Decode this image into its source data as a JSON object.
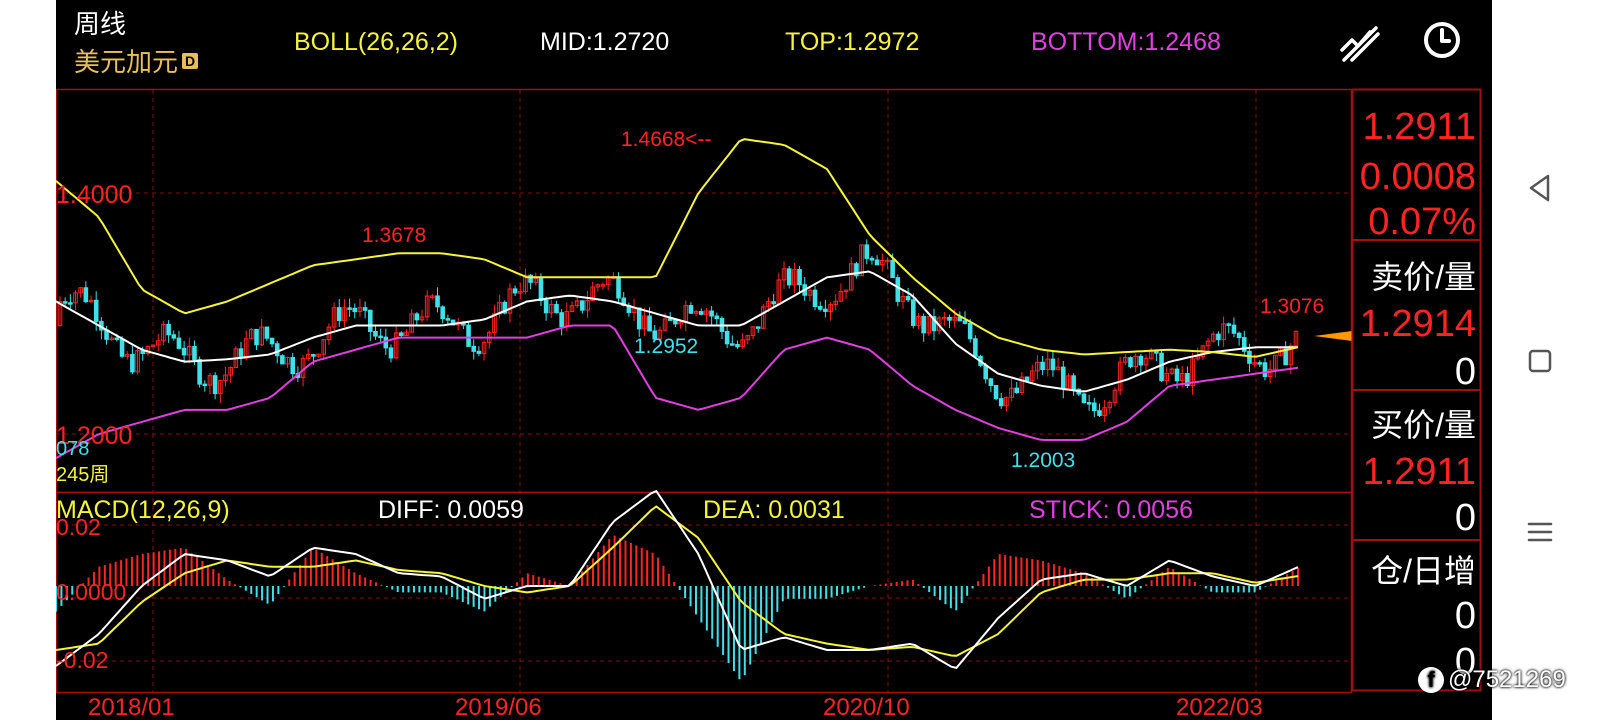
{
  "header": {
    "period": "周线",
    "instrument": "美元加元",
    "instrument_badge": "D",
    "boll_label": "BOLL(26,26,2)",
    "mid_label": "MID:1.2720",
    "top_label": "TOP:1.2972",
    "bottom_label": "BOTTOM:1.2468",
    "tool_icons": [
      "trend-line-icon",
      "clock-icon"
    ]
  },
  "quote_panel": {
    "price": "1.2911",
    "change": "0.0008",
    "change_pct": "0.07%",
    "ask_title": "卖价/量",
    "ask_price": "1.2914",
    "ask_volume": "0",
    "bid_title": "买价/量",
    "bid_price": "1.2911",
    "bid_volume": "0",
    "oi_title": "仓/日增",
    "oi_value": "0",
    "oi_change": "0"
  },
  "price_chart": {
    "y_tick_labels": [
      "1.4000",
      "1.2000"
    ],
    "left_value": "078",
    "left_period": "245周",
    "annotations": [
      "1.4668<--",
      "1.3678",
      "1.2952",
      "1.2003",
      "1.3076"
    ]
  },
  "macd_panel": {
    "label": "MACD(12,26,9)",
    "diff_label": "DIFF: 0.0059",
    "dea_label": "DEA: 0.0031",
    "stick_label": "STICK: 0.0056",
    "y_tick_labels": [
      "0.02",
      "0.0000",
      "-0.02"
    ]
  },
  "x_axis_labels": [
    "2018/01",
    "2019/06",
    "2020/10",
    "2022/03"
  ],
  "watermark": "@7521269",
  "colors": {
    "red": "#ff2424",
    "cyan": "#40e0e8",
    "yellow": "#f4f43c",
    "magenta": "#e040e0",
    "white": "#ffffff",
    "grid": "#8a1010",
    "background": "#000000"
  },
  "chart_data": [
    {
      "type": "candlestick",
      "title": "BOLL(26,26,2)",
      "ylim": [
        1.16,
        1.49
      ],
      "y_ticks": [
        1.4,
        1.2
      ],
      "x_ticks": [
        "2018/01",
        "2019/06",
        "2020/10",
        "2022/03"
      ],
      "grid": true,
      "series": [
        {
          "name": "MID",
          "values": [
            1.31,
            1.29,
            1.27,
            1.26,
            1.262,
            1.266,
            1.28,
            1.29,
            1.29,
            1.29,
            1.295,
            1.31,
            1.315,
            1.31,
            1.3,
            1.29,
            1.29,
            1.31,
            1.33,
            1.335,
            1.315,
            1.275,
            1.25,
            1.24,
            1.235,
            1.245,
            1.26,
            1.268,
            1.272,
            1.272
          ]
        },
        {
          "name": "TOP",
          "values": [
            1.41,
            1.38,
            1.32,
            1.3,
            1.31,
            1.325,
            1.34,
            1.345,
            1.35,
            1.35,
            1.345,
            1.33,
            1.33,
            1.33,
            1.33,
            1.4,
            1.445,
            1.44,
            1.42,
            1.365,
            1.33,
            1.3,
            1.28,
            1.27,
            1.266,
            1.268,
            1.27,
            1.268,
            1.264,
            1.272
          ]
        },
        {
          "name": "BOTTOM",
          "values": [
            1.18,
            1.2,
            1.21,
            1.22,
            1.22,
            1.23,
            1.26,
            1.27,
            1.28,
            1.28,
            1.28,
            1.28,
            1.29,
            1.29,
            1.23,
            1.22,
            1.23,
            1.27,
            1.28,
            1.27,
            1.24,
            1.22,
            1.205,
            1.195,
            1.195,
            1.21,
            1.24,
            1.245,
            1.25,
            1.255
          ]
        }
      ],
      "annotations": [
        {
          "label": "1.4668",
          "value": 1.4668
        },
        {
          "label": "1.3678",
          "value": 1.3678
        },
        {
          "label": "1.2952",
          "value": 1.2952
        },
        {
          "label": "1.2003",
          "value": 1.2003
        },
        {
          "label": "1.3076",
          "value": 1.3076
        }
      ],
      "last_price": 1.2911
    },
    {
      "type": "bar",
      "title": "MACD(12,26,9)",
      "ylim": [
        -0.03,
        0.027
      ],
      "y_ticks": [
        0.02,
        0,
        -0.02
      ],
      "series": [
        {
          "name": "DIFF",
          "values": [
            -0.025,
            -0.015,
            0.0,
            0.01,
            0.008,
            0.003,
            0.012,
            0.01,
            0.004,
            0.003,
            -0.004,
            0.0,
            0.0,
            0.02,
            0.03,
            0.01,
            -0.02,
            -0.016,
            -0.02,
            -0.02,
            -0.018,
            -0.026,
            -0.01,
            0.002,
            0.004,
            0.0,
            0.008,
            0.003,
            0.0,
            0.0059
          ]
        },
        {
          "name": "DEA",
          "values": [
            -0.02,
            -0.018,
            -0.005,
            0.004,
            0.008,
            0.006,
            0.006,
            0.008,
            0.005,
            0.004,
            0.0,
            -0.002,
            0.0,
            0.012,
            0.025,
            0.015,
            -0.005,
            -0.015,
            -0.018,
            -0.02,
            -0.019,
            -0.022,
            -0.015,
            -0.002,
            0.002,
            0.002,
            0.004,
            0.004,
            0.001,
            0.0031
          ]
        },
        {
          "name": "STICK",
          "values": [
            -0.008,
            0.006,
            0.01,
            0.012,
            0.002,
            -0.006,
            0.012,
            0.004,
            -0.002,
            -0.002,
            -0.008,
            0.004,
            0.0,
            0.016,
            0.01,
            -0.01,
            -0.03,
            -0.004,
            -0.004,
            0.0,
            0.002,
            -0.008,
            0.01,
            0.008,
            0.004,
            -0.004,
            0.006,
            -0.002,
            -0.002,
            0.0056
          ]
        }
      ]
    }
  ]
}
